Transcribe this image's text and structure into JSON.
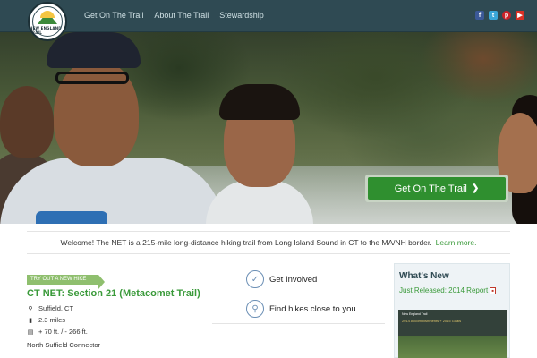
{
  "header": {
    "logo_text": "NEW ENGLAND TRAIL",
    "nav": [
      "Get On The Trail",
      "About The Trail",
      "Stewardship"
    ],
    "social_icons": [
      "facebook-icon",
      "twitter-icon",
      "pinterest-icon",
      "youtube-icon"
    ],
    "social_glyphs": [
      "f",
      "t",
      "p",
      "▶"
    ]
  },
  "hero": {
    "cta_label": "Get On The Trail",
    "cta_icon": "chevron-right-icon"
  },
  "welcome": {
    "text": "Welcome! The NET is a 215-mile long-distance hiking trail from Long Island Sound in CT to the MA/NH border.",
    "link": "Learn more."
  },
  "hike": {
    "ribbon": "TRY OUT A NEW HIKE",
    "title": "CT NET: Section 21 (Metacomet Trail)",
    "location": "Suffield, CT",
    "distance": "2.3 miles",
    "elevation": "+ 70 ft. / - 266 ft.",
    "connector": "North Suffield Connector"
  },
  "actions": {
    "get_involved": "Get Involved",
    "find_hikes": "Find hikes close to you"
  },
  "whats_new": {
    "title": "What's New",
    "report": "Just Released: 2014 Report",
    "thumb_title": "New England Trail",
    "thumb_subtitle": "2014 Accomplishments + 2015 Goals"
  },
  "colors": {
    "header_bg": "#2f4a53",
    "accent_green": "#3a9a3a",
    "cta_green": "#2f8f2f"
  }
}
